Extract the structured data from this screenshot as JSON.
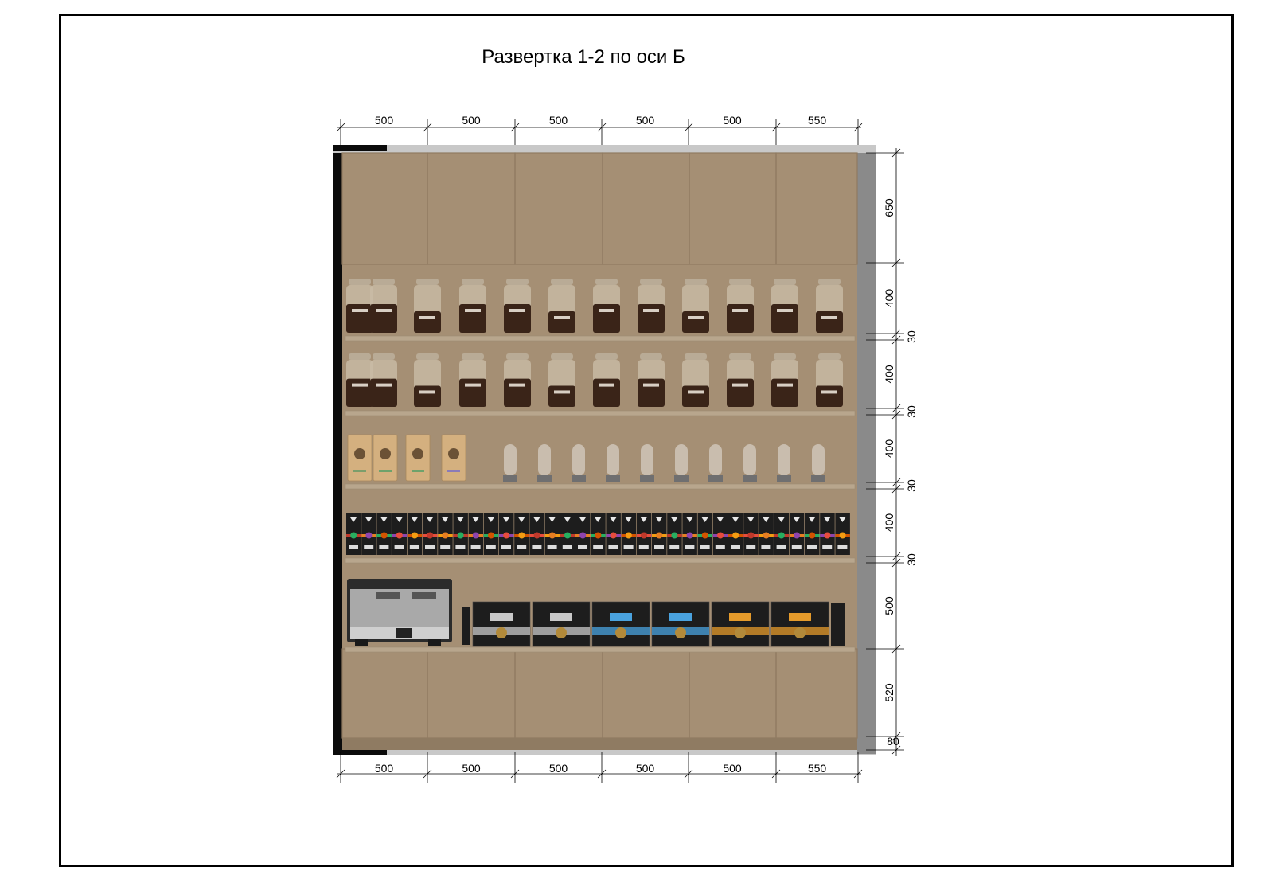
{
  "title": "Развертка 1-2 по оси Б",
  "colors": {
    "wood": "#a58f74",
    "wood_dark": "#8f7b62",
    "side_panel": "#8a8a8a",
    "edge_black": "#0b0b0b",
    "shelf": "#b8a68d",
    "jar_glass": "#c9bba6",
    "coffee": "#3a2418",
    "kraft_bag": "#d4b07f",
    "capsule_box": "#1d1d1d"
  },
  "dimensions": {
    "top": [
      "500",
      "500",
      "500",
      "500",
      "500",
      "550"
    ],
    "bottom": [
      "500",
      "500",
      "500",
      "500",
      "500",
      "550"
    ],
    "right_main": [
      "650",
      "400",
      "400",
      "400",
      "400",
      "500",
      "520",
      "80"
    ],
    "right_shelf": [
      "30",
      "30",
      "30",
      "30"
    ]
  },
  "items": {
    "row1": "coffee-bean-jars",
    "row2": "coffee-bean-jars",
    "row3": [
      "kraft-coffee-bags",
      "glass-dispensers"
    ],
    "row4": "coffee-capsule-boxes",
    "row5": [
      "espresso-machine",
      "coffee-capsule-packs"
    ]
  }
}
